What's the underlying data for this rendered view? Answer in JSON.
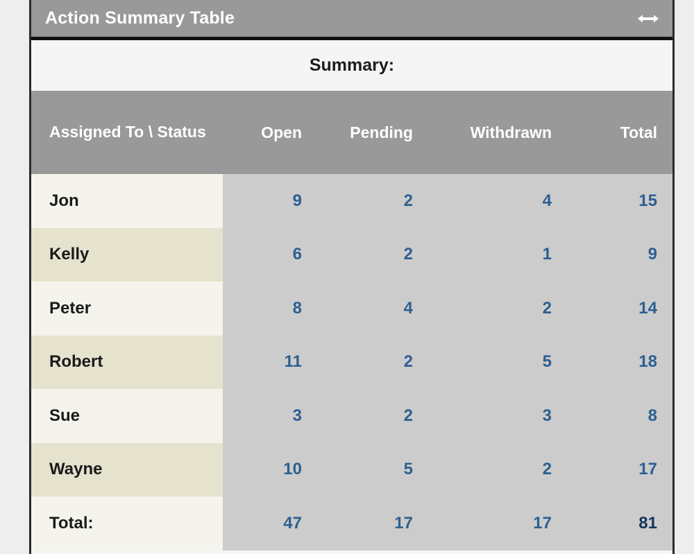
{
  "page": {
    "background_color": "#eeeeee"
  },
  "portlet": {
    "title": "Action Summary Table",
    "title_bar_color": "#999999",
    "resize_icon": "horizontal-resize-arrow-icon",
    "caption": "Summary:"
  },
  "table": {
    "corner_header": "Assigned To \\ Status",
    "columns": [
      {
        "key": "open",
        "label": "Open"
      },
      {
        "key": "pending",
        "label": "Pending"
      },
      {
        "key": "withdrawn",
        "label": "Withdrawn"
      },
      {
        "key": "total",
        "label": "Total"
      }
    ],
    "rows": [
      {
        "name": "Jon",
        "open": "9",
        "pending": "2",
        "withdrawn": "4",
        "total": "15"
      },
      {
        "name": "Kelly",
        "open": "6",
        "pending": "2",
        "withdrawn": "1",
        "total": "9"
      },
      {
        "name": "Peter",
        "open": "8",
        "pending": "4",
        "withdrawn": "2",
        "total": "14"
      },
      {
        "name": "Robert",
        "open": "11",
        "pending": "2",
        "withdrawn": "5",
        "total": "18"
      },
      {
        "name": "Sue",
        "open": "3",
        "pending": "2",
        "withdrawn": "3",
        "total": "8"
      },
      {
        "name": "Wayne",
        "open": "10",
        "pending": "5",
        "withdrawn": "2",
        "total": "17"
      }
    ],
    "total_row": {
      "name": "Total:",
      "open": "47",
      "pending": "17",
      "withdrawn": "17",
      "total": "81"
    },
    "colors": {
      "header_background": "#999999",
      "header_text": "#ffffff",
      "data_background": "#cccccc",
      "value_text": "#2d5f91",
      "label_text": "#1a1a1a",
      "row_light": "#f5f4ec",
      "row_alt": "#e5e2cd",
      "caption_background": "#f5f5f5"
    }
  },
  "chart_data": {
    "type": "table",
    "title": "Action Summary Table",
    "subtitle": "Summary:",
    "xlabel": "Status",
    "ylabel": "Assigned To",
    "categories": [
      "Open",
      "Pending",
      "Withdrawn",
      "Total"
    ],
    "row_labels": [
      "Jon",
      "Kelly",
      "Peter",
      "Robert",
      "Sue",
      "Wayne",
      "Total:"
    ],
    "series": [
      {
        "name": "Jon",
        "values": [
          9,
          2,
          4,
          15
        ]
      },
      {
        "name": "Kelly",
        "values": [
          6,
          2,
          1,
          9
        ]
      },
      {
        "name": "Peter",
        "values": [
          8,
          4,
          2,
          14
        ]
      },
      {
        "name": "Robert",
        "values": [
          11,
          2,
          5,
          18
        ]
      },
      {
        "name": "Sue",
        "values": [
          3,
          2,
          3,
          8
        ]
      },
      {
        "name": "Wayne",
        "values": [
          10,
          5,
          2,
          17
        ]
      },
      {
        "name": "Total:",
        "values": [
          47,
          17,
          17,
          81
        ]
      }
    ]
  }
}
